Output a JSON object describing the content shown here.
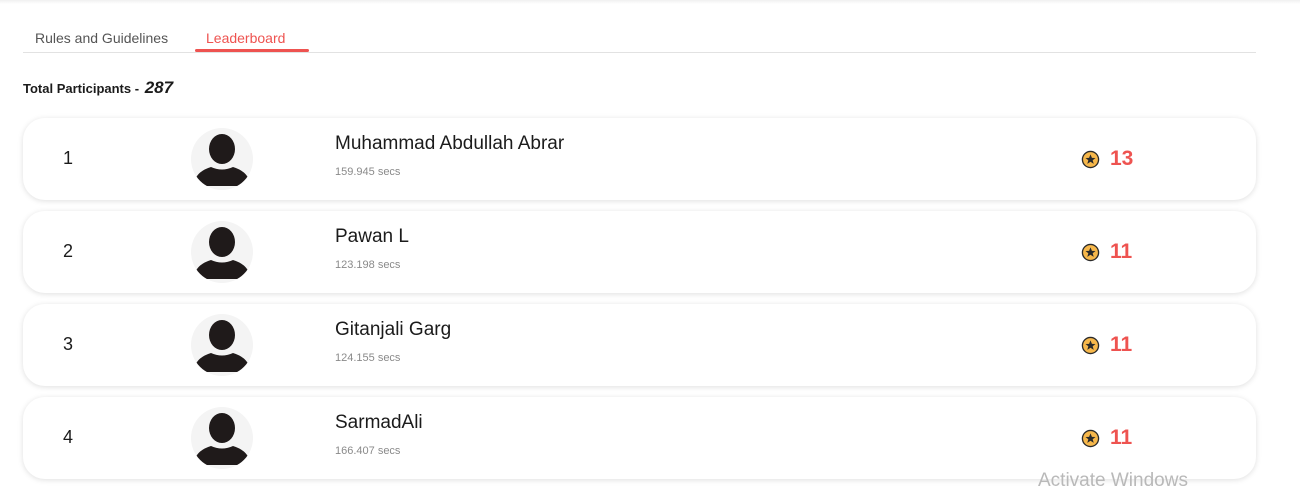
{
  "tabs": [
    {
      "label": "Rules and Guidelines",
      "active": false
    },
    {
      "label": "Leaderboard",
      "active": true
    }
  ],
  "total": {
    "label": "Total Participants -",
    "count": "287"
  },
  "leaderboard": [
    {
      "rank": "1",
      "name": "Muhammad Abdullah Abrar",
      "time": "159.945 secs",
      "points": "13"
    },
    {
      "rank": "2",
      "name": "Pawan L",
      "time": "123.198 secs",
      "points": "11"
    },
    {
      "rank": "3",
      "name": "Gitanjali Garg",
      "time": "124.155 secs",
      "points": "11"
    },
    {
      "rank": "4",
      "name": "SarmadAli",
      "time": "166.407 secs",
      "points": "11"
    }
  ],
  "icons": {
    "avatar": "user-silhouette-icon",
    "score": "star-coin-icon"
  },
  "colors": {
    "accent": "#ee5350",
    "coin": "#f7b84b"
  },
  "watermark": "Activate Windows"
}
